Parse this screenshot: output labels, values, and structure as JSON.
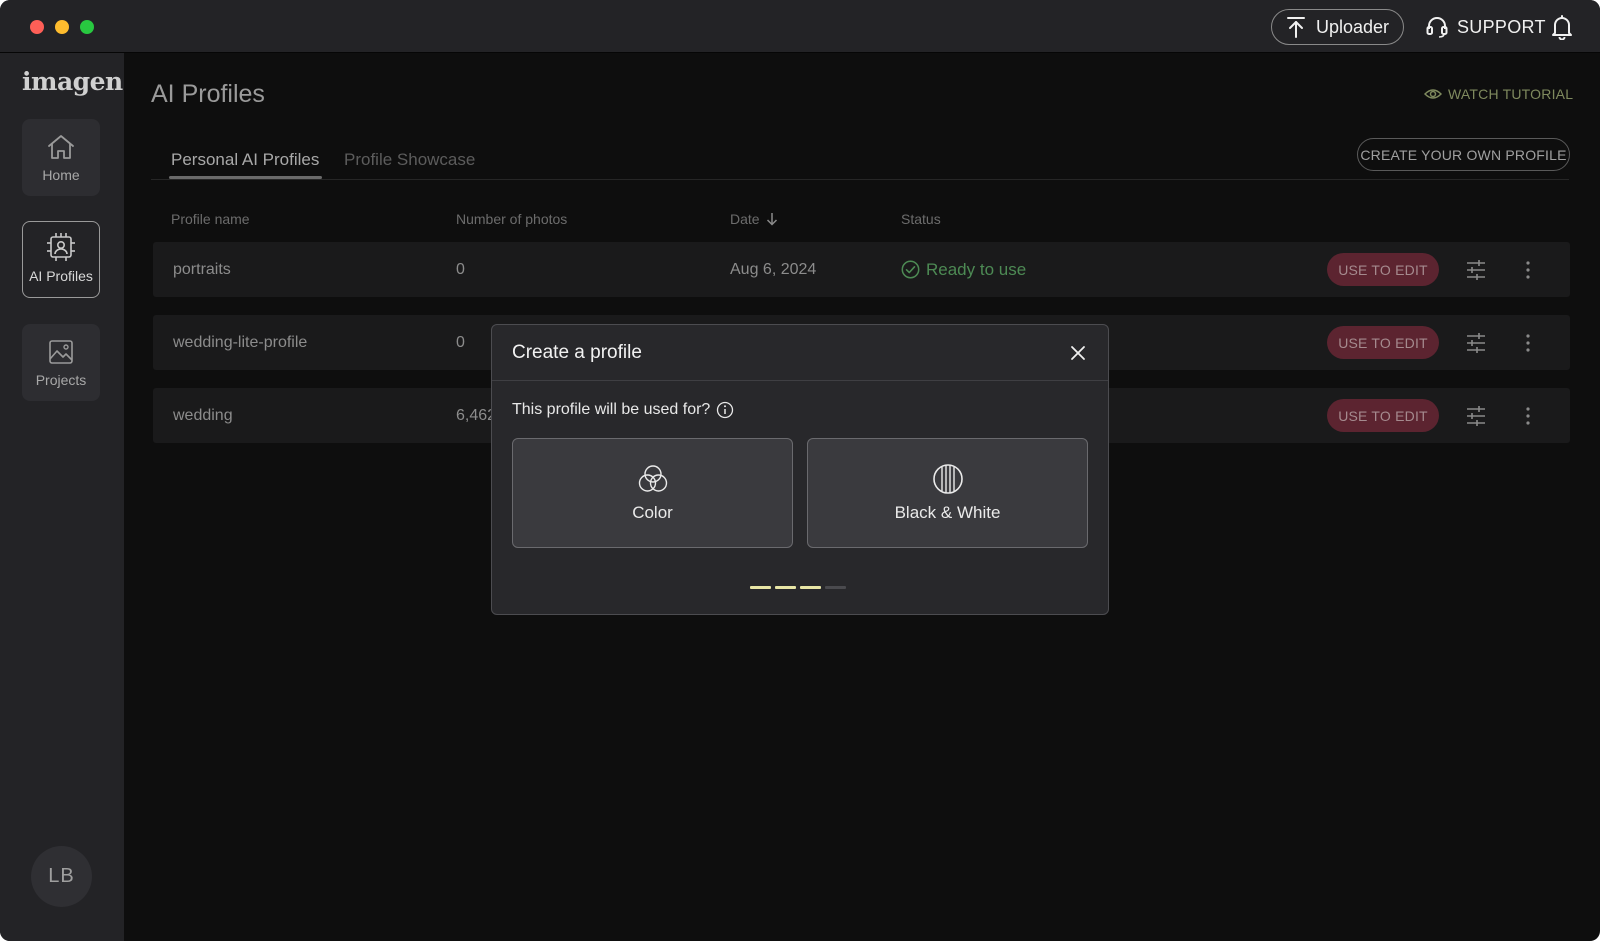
{
  "titlebar": {
    "uploader_label": "Uploader",
    "support_label": "SUPPORT"
  },
  "sidebar": {
    "logo": "imagen",
    "items": [
      {
        "label": "Home",
        "icon": "home-icon"
      },
      {
        "label": "AI Profiles",
        "icon": "ai-profile-icon",
        "active": true
      },
      {
        "label": "Projects",
        "icon": "projects-icon"
      }
    ],
    "avatar_initials": "LB"
  },
  "main": {
    "title": "AI Profiles",
    "watch_tutorial": "WATCH TUTORIAL",
    "tabs": [
      {
        "label": "Personal AI Profiles",
        "active": true
      },
      {
        "label": "Profile Showcase",
        "active": false
      }
    ],
    "create_button": "CREATE YOUR OWN PROFILE",
    "table": {
      "headers": [
        "Profile name",
        "Number of photos",
        "Date",
        "Status"
      ],
      "sort": "Date descending",
      "rows": [
        {
          "name": "portraits",
          "photos": "0",
          "date": "Aug 6, 2024",
          "status": "Ready to use",
          "action": "USE TO EDIT"
        },
        {
          "name": "wedding-lite-profile",
          "photos": "0",
          "date": "",
          "status": "",
          "action": "USE TO EDIT"
        },
        {
          "name": "wedding",
          "photos": "6,462",
          "date": "",
          "status": "",
          "action": "USE TO EDIT"
        }
      ]
    }
  },
  "modal": {
    "title": "Create a profile",
    "question": "This profile will be used for?",
    "options": [
      {
        "label": "Color",
        "icon": "color-circles-icon"
      },
      {
        "label": "Black & White",
        "icon": "bw-stripes-icon"
      }
    ],
    "step": 3,
    "total_steps": 4
  },
  "colors": {
    "accent_status": "#4d8a54",
    "use_button_bg": "#5c2430",
    "progress_done": "#e8e6a6",
    "tutorial": "#7f8a5e"
  }
}
